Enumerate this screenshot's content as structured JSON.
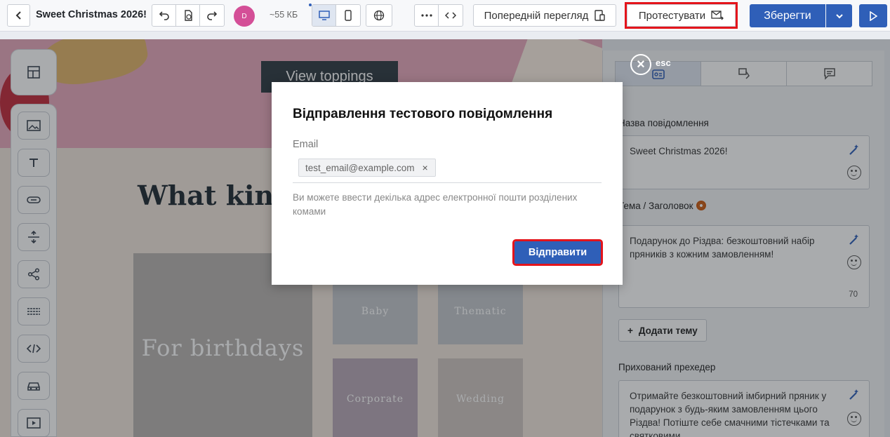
{
  "topbar": {
    "title": "Sweet Christmas 2026!",
    "avatar_initial": "D",
    "size": "~55 КБ",
    "preview_label": "Попередній перегляд",
    "test_label": "Протестувати",
    "save_label": "Зберегти"
  },
  "canvas": {
    "hero_button": "View toppings",
    "headline": "What kin",
    "cards": [
      "For birthdays",
      "Baby",
      "Thematic",
      "Corporate",
      "Wedding"
    ]
  },
  "overlay": {
    "esc_label": "esc"
  },
  "modal": {
    "title": "Відправлення тестового повідомлення",
    "email_label": "Email",
    "email_chip": "test_email@example.com",
    "hint": "Ви можете ввести декілька адрес електронної пошти розділених комами",
    "send_label": "Відправити"
  },
  "right_panel": {
    "message_name_label": "Назва повідомлення",
    "message_name_value": "Sweet Christmas 2026!",
    "subject_label": "Тема / Заголовок",
    "subject_value": "Подарунок до Різдва: безкоштовний набір пряників з кожним замовленням!",
    "subject_counter": "70",
    "add_topic_label": "Додати тему",
    "preheader_label": "Прихований прехедер",
    "preheader_value": "Отримайте безкоштовний імбирний пряник у подарунок з будь-яким замовленням цього Різдва! Потіште себе смачними тістечками та святковими"
  },
  "colors": {
    "primary": "#2f5fb8",
    "highlight": "#e4141b",
    "avatar": "#d44f97"
  }
}
